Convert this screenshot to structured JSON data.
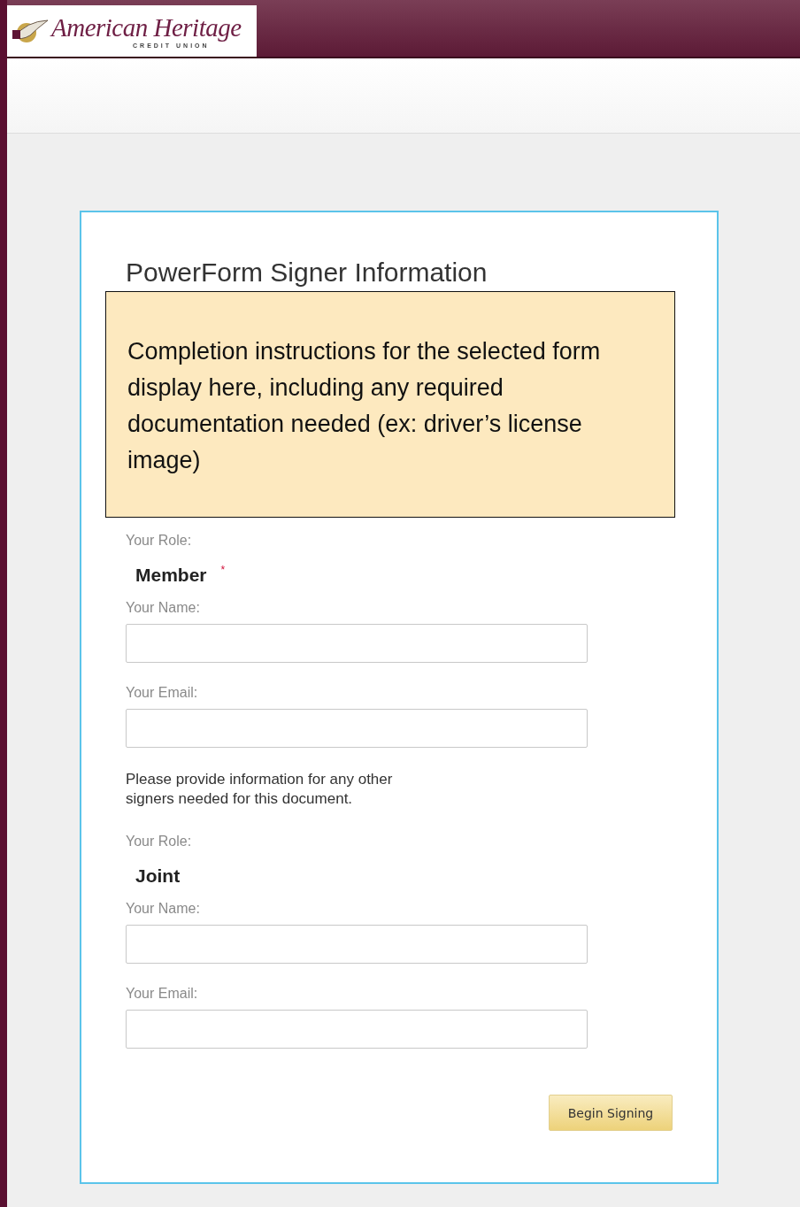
{
  "header": {
    "logo_name": "American Heritage",
    "logo_tagline": "CREDIT UNION"
  },
  "form": {
    "title": "PowerForm Signer Information",
    "instructions": "Completion instructions for the selected form display here, including any required documentation needed (ex: driver’s license image)",
    "signers": [
      {
        "role_label": "Your Role:",
        "role": "Member",
        "required_mark": "*",
        "name_label": "Your Name:",
        "email_label": "Your Email:"
      },
      {
        "role_label": "Your Role:",
        "role": "Joint",
        "name_label": "Your Name:",
        "email_label": "Your Email:"
      }
    ],
    "other_signers_note": "Please provide information for any other signers needed for this document.",
    "submit_button": "Begin Signing"
  }
}
